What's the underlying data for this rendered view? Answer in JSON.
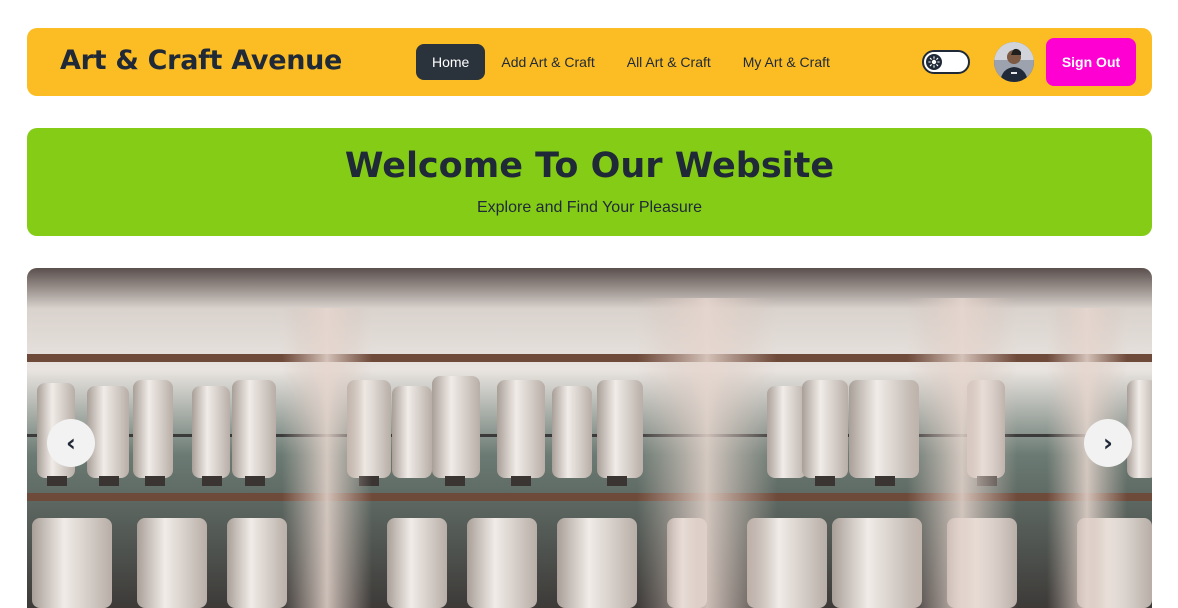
{
  "header": {
    "brand": "Art & Craft Avenue",
    "nav": [
      {
        "label": "Home",
        "active": true
      },
      {
        "label": "Add Art & Craft",
        "active": false
      },
      {
        "label": "All Art & Craft",
        "active": false
      },
      {
        "label": "My Art & Craft",
        "active": false
      }
    ],
    "theme_toggle_icon": "sun-icon",
    "avatar_icon": "user-avatar",
    "sign_out_label": "Sign Out"
  },
  "hero": {
    "title": "Welcome To Our Website",
    "subtitle": "Explore and Find Your Pleasure"
  },
  "carousel": {
    "image": "spools-of-thread-image",
    "prev_label": "‹",
    "next_label": "›"
  },
  "colors": {
    "navbar_bg": "#fbbd23",
    "active_nav_bg": "#2a323c",
    "sign_out_bg": "#ff00d3",
    "hero_bg": "#84cc16",
    "text_dark": "#1f2937"
  }
}
